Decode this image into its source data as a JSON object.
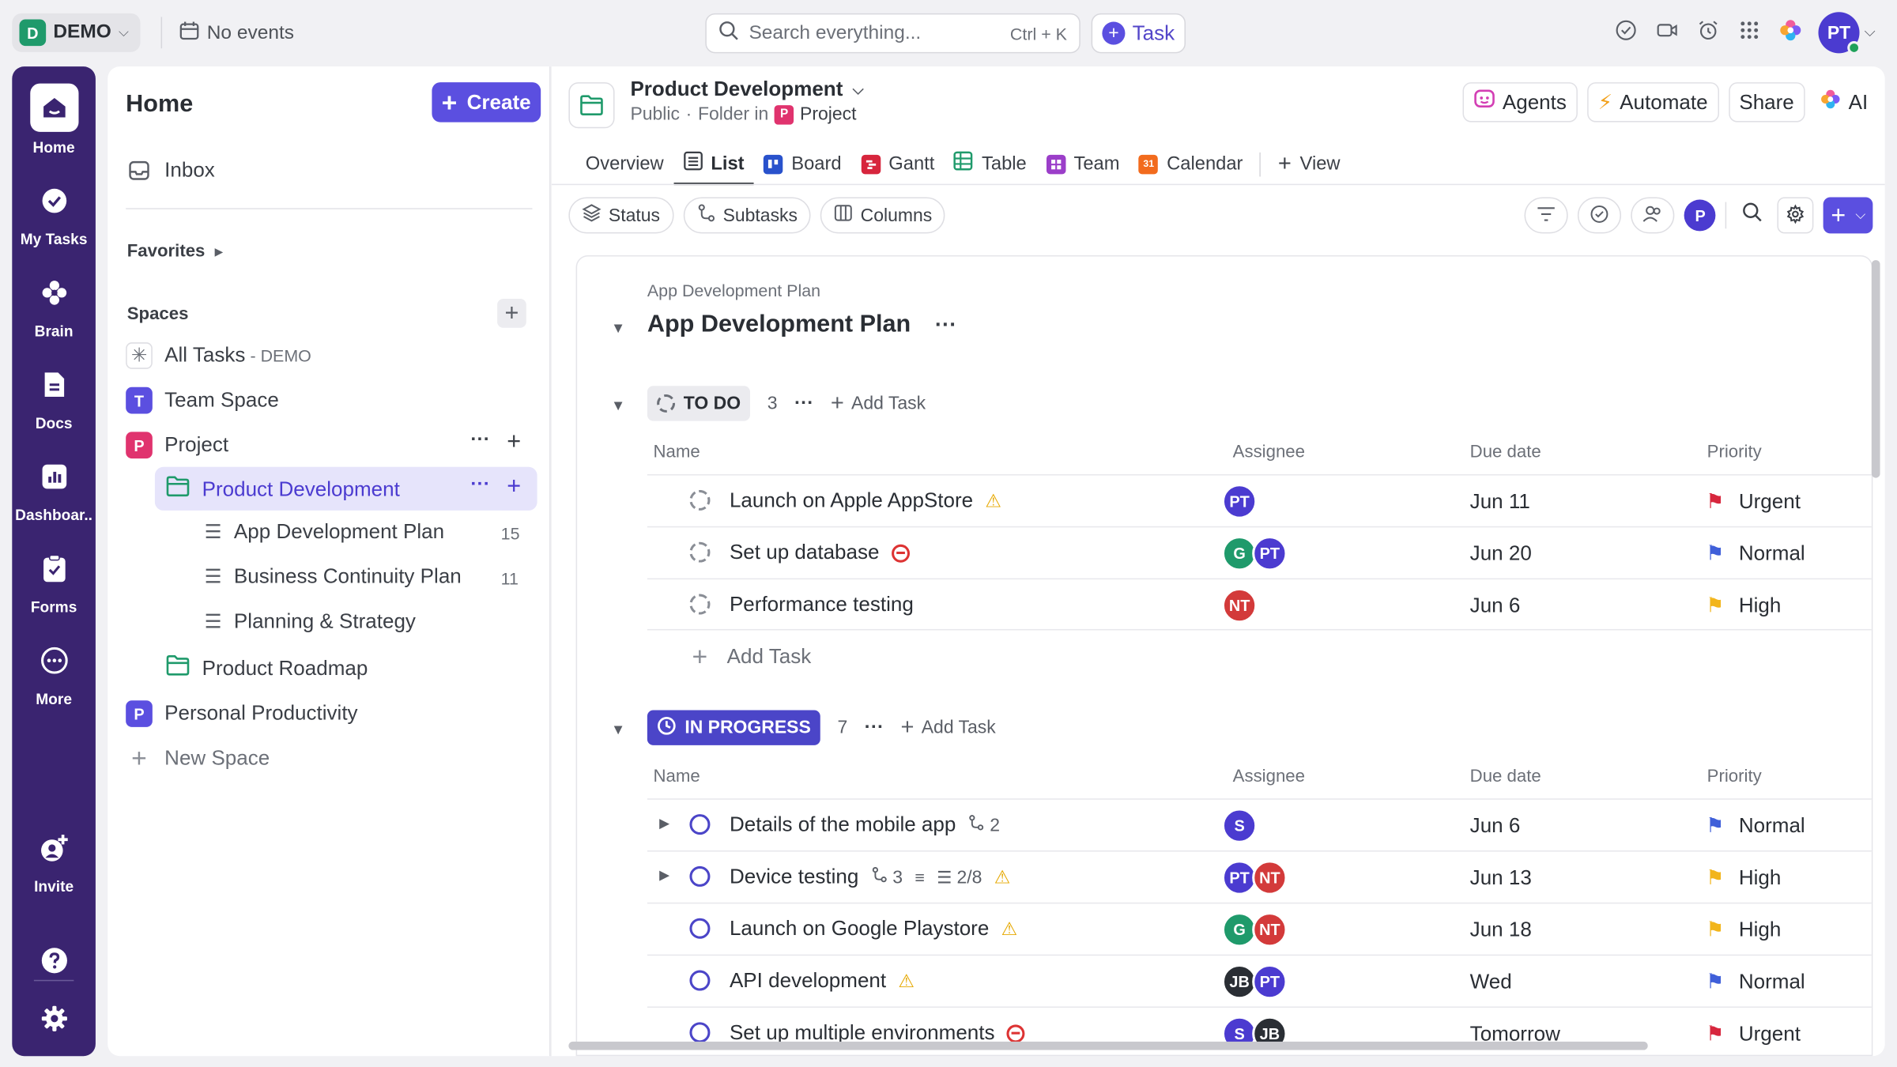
{
  "topbar": {
    "workspace_letter": "D",
    "workspace_name": "DEMO",
    "events_label": "No events",
    "search_placeholder": "Search everything...",
    "search_shortcut": "Ctrl + K",
    "task_button": "Task",
    "avatar": "PT"
  },
  "rail": {
    "items": [
      {
        "label": "Home"
      },
      {
        "label": "My Tasks"
      },
      {
        "label": "Brain"
      },
      {
        "label": "Docs"
      },
      {
        "label": "Dashboar.."
      },
      {
        "label": "Forms"
      },
      {
        "label": "More"
      },
      {
        "label": "Invite"
      }
    ]
  },
  "sidebar": {
    "title": "Home",
    "create_label": "Create",
    "inbox": "Inbox",
    "favorites": "Favorites",
    "spaces": "Spaces",
    "all_tasks": "All Tasks",
    "all_tasks_suffix": "- DEMO",
    "team_space": "Team Space",
    "project": "Project",
    "product_development": "Product Development",
    "lists": [
      {
        "name": "App Development Plan",
        "count": "15"
      },
      {
        "name": "Business Continuity Plan",
        "count": "11"
      },
      {
        "name": "Planning & Strategy",
        "count": ""
      }
    ],
    "product_roadmap": "Product Roadmap",
    "personal_productivity": "Personal Productivity",
    "new_space": "New Space",
    "letters": {
      "team": "T",
      "project": "P",
      "personal": "P"
    }
  },
  "header": {
    "title": "Product Development",
    "visibility": "Public",
    "folder_in": "Folder in",
    "parent": "Project",
    "parent_letter": "P",
    "agents": "Agents",
    "automate": "Automate",
    "share": "Share",
    "ai": "AI"
  },
  "tabs": [
    {
      "label": "Overview"
    },
    {
      "label": "List"
    },
    {
      "label": "Board"
    },
    {
      "label": "Gantt"
    },
    {
      "label": "Table"
    },
    {
      "label": "Team"
    },
    {
      "label": "Calendar"
    },
    {
      "label": "View"
    }
  ],
  "toolbar": {
    "status": "Status",
    "subtasks": "Subtasks",
    "columns": "Columns",
    "me_letter": "P"
  },
  "list": {
    "breadcrumb": "App Development Plan",
    "title": "App Development Plan",
    "columns": {
      "name": "Name",
      "assignee": "Assignee",
      "due": "Due date",
      "priority": "Priority"
    },
    "add_task": "Add Task",
    "groups": [
      {
        "status": "TO DO",
        "count": "3",
        "tasks": [
          {
            "name": "Launch on Apple AppStore",
            "assignees": [
              "PT"
            ],
            "due": "Jun 11",
            "priority": "Urgent"
          },
          {
            "name": "Set up database",
            "assignees": [
              "G",
              "PT"
            ],
            "due": "Jun 20",
            "priority": "Normal"
          },
          {
            "name": "Performance testing",
            "assignees": [
              "NT"
            ],
            "due": "Jun 6",
            "priority": "High"
          }
        ]
      },
      {
        "status": "IN PROGRESS",
        "count": "7",
        "tasks": [
          {
            "name": "Details of the mobile app",
            "subtasks": "2",
            "assignees": [
              "S"
            ],
            "due": "Jun 6",
            "priority": "Normal"
          },
          {
            "name": "Device testing",
            "subtasks": "3",
            "checklist": "2/8",
            "assignees": [
              "PT",
              "NT"
            ],
            "due": "Jun 13",
            "priority": "High"
          },
          {
            "name": "Launch on Google Playstore",
            "assignees": [
              "G",
              "NT"
            ],
            "due": "Jun 18",
            "priority": "High"
          },
          {
            "name": "API development",
            "assignees": [
              "JB",
              "PT"
            ],
            "due": "Wed",
            "priority": "Normal"
          },
          {
            "name": "Set up multiple environments",
            "assignees": [
              "S",
              "JB"
            ],
            "due": "Tomorrow",
            "priority": "Urgent"
          }
        ]
      }
    ]
  },
  "colors": {
    "accent": "#5b4fe0",
    "rail": "#3a2470",
    "urgent": "#d7263d",
    "normal": "#3f5fd9",
    "high": "#f2b51b"
  }
}
